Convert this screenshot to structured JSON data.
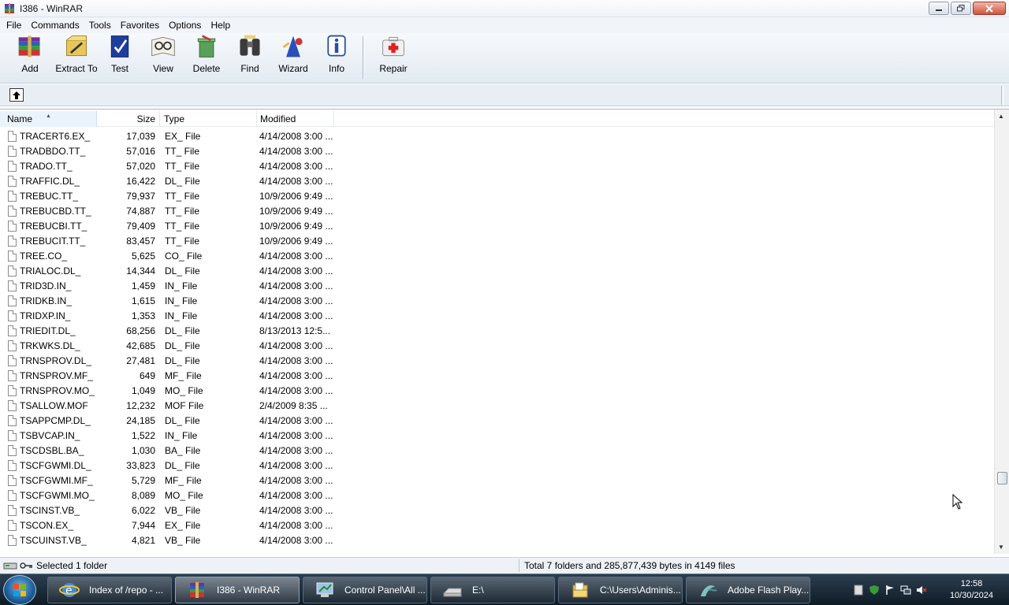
{
  "window": {
    "title": "I386 - WinRAR"
  },
  "menu": [
    "File",
    "Commands",
    "Tools",
    "Favorites",
    "Options",
    "Help"
  ],
  "toolbar": {
    "buttons": [
      {
        "label": "Add",
        "icon": "add-archive-icon"
      },
      {
        "label": "Extract To",
        "icon": "extract-to-icon"
      },
      {
        "label": "Test",
        "icon": "test-icon"
      },
      {
        "label": "View",
        "icon": "view-icon"
      },
      {
        "label": "Delete",
        "icon": "delete-icon"
      },
      {
        "label": "Find",
        "icon": "find-binoculars-icon"
      },
      {
        "label": "Wizard",
        "icon": "wizard-icon"
      },
      {
        "label": "Info",
        "icon": "info-icon"
      },
      {
        "label": "Repair",
        "icon": "repair-firstaid-icon"
      }
    ]
  },
  "columns": {
    "name": "Name",
    "size": "Size",
    "type": "Type",
    "modified": "Modified"
  },
  "files": [
    {
      "name": "TRACERT6.EX_",
      "size": "17,039",
      "type": "EX_ File",
      "modified": "4/14/2008 3:00 ..."
    },
    {
      "name": "TRADBDO.TT_",
      "size": "57,016",
      "type": "TT_ File",
      "modified": "4/14/2008 3:00 ..."
    },
    {
      "name": "TRADO.TT_",
      "size": "57,020",
      "type": "TT_ File",
      "modified": "4/14/2008 3:00 ..."
    },
    {
      "name": "TRAFFIC.DL_",
      "size": "16,422",
      "type": "DL_ File",
      "modified": "4/14/2008 3:00 ..."
    },
    {
      "name": "TREBUC.TT_",
      "size": "79,937",
      "type": "TT_ File",
      "modified": "10/9/2006 9:49 ..."
    },
    {
      "name": "TREBUCBD.TT_",
      "size": "74,887",
      "type": "TT_ File",
      "modified": "10/9/2006 9:49 ..."
    },
    {
      "name": "TREBUCBI.TT_",
      "size": "79,409",
      "type": "TT_ File",
      "modified": "10/9/2006 9:49 ..."
    },
    {
      "name": "TREBUCIT.TT_",
      "size": "83,457",
      "type": "TT_ File",
      "modified": "10/9/2006 9:49 ..."
    },
    {
      "name": "TREE.CO_",
      "size": "5,625",
      "type": "CO_ File",
      "modified": "4/14/2008 3:00 ..."
    },
    {
      "name": "TRIALOC.DL_",
      "size": "14,344",
      "type": "DL_ File",
      "modified": "4/14/2008 3:00 ..."
    },
    {
      "name": "TRID3D.IN_",
      "size": "1,459",
      "type": "IN_ File",
      "modified": "4/14/2008 3:00 ..."
    },
    {
      "name": "TRIDKB.IN_",
      "size": "1,615",
      "type": "IN_ File",
      "modified": "4/14/2008 3:00 ..."
    },
    {
      "name": "TRIDXP.IN_",
      "size": "1,353",
      "type": "IN_ File",
      "modified": "4/14/2008 3:00 ..."
    },
    {
      "name": "TRIEDIT.DL_",
      "size": "68,256",
      "type": "DL_ File",
      "modified": "8/13/2013 12:5..."
    },
    {
      "name": "TRKWKS.DL_",
      "size": "42,685",
      "type": "DL_ File",
      "modified": "4/14/2008 3:00 ..."
    },
    {
      "name": "TRNSPROV.DL_",
      "size": "27,481",
      "type": "DL_ File",
      "modified": "4/14/2008 3:00 ..."
    },
    {
      "name": "TRNSPROV.MF_",
      "size": "649",
      "type": "MF_ File",
      "modified": "4/14/2008 3:00 ..."
    },
    {
      "name": "TRNSPROV.MO_",
      "size": "1,049",
      "type": "MO_ File",
      "modified": "4/14/2008 3:00 ..."
    },
    {
      "name": "TSALLOW.MOF",
      "size": "12,232",
      "type": "MOF File",
      "modified": "2/4/2009 8:35 ..."
    },
    {
      "name": "TSAPPCMP.DL_",
      "size": "24,185",
      "type": "DL_ File",
      "modified": "4/14/2008 3:00 ..."
    },
    {
      "name": "TSBVCAP.IN_",
      "size": "1,522",
      "type": "IN_ File",
      "modified": "4/14/2008 3:00 ..."
    },
    {
      "name": "TSCDSBL.BA_",
      "size": "1,030",
      "type": "BA_ File",
      "modified": "4/14/2008 3:00 ..."
    },
    {
      "name": "TSCFGWMI.DL_",
      "size": "33,823",
      "type": "DL_ File",
      "modified": "4/14/2008 3:00 ..."
    },
    {
      "name": "TSCFGWMI.MF_",
      "size": "5,729",
      "type": "MF_ File",
      "modified": "4/14/2008 3:00 ..."
    },
    {
      "name": "TSCFGWMI.MO_",
      "size": "8,089",
      "type": "MO_ File",
      "modified": "4/14/2008 3:00 ..."
    },
    {
      "name": "TSCINST.VB_",
      "size": "6,022",
      "type": "VB_ File",
      "modified": "4/14/2008 3:00 ..."
    },
    {
      "name": "TSCON.EX_",
      "size": "7,944",
      "type": "EX_ File",
      "modified": "4/14/2008 3:00 ..."
    },
    {
      "name": "TSCUINST.VB_",
      "size": "4,821",
      "type": "VB_ File",
      "modified": "4/14/2008 3:00 ..."
    }
  ],
  "status": {
    "selection": "Selected 1 folder",
    "total": "Total 7 folders and 285,877,439 bytes in 4149 files"
  },
  "taskbar": {
    "items": [
      {
        "label": "Index of /repo - ...",
        "icon": "internet-explorer-icon"
      },
      {
        "label": "I386 - WinRAR",
        "icon": "winrar-icon",
        "active": true
      },
      {
        "label": "Control Panel\\All ...",
        "icon": "control-panel-icon"
      },
      {
        "label": "E:\\",
        "icon": "drive-icon"
      },
      {
        "label": "C:\\Users\\Adminis...",
        "icon": "folder-icon"
      },
      {
        "label": "Adobe Flash Play...",
        "icon": "flash-player-icon"
      }
    ],
    "clock": {
      "time": "12:58",
      "date": "10/30/2024"
    }
  }
}
